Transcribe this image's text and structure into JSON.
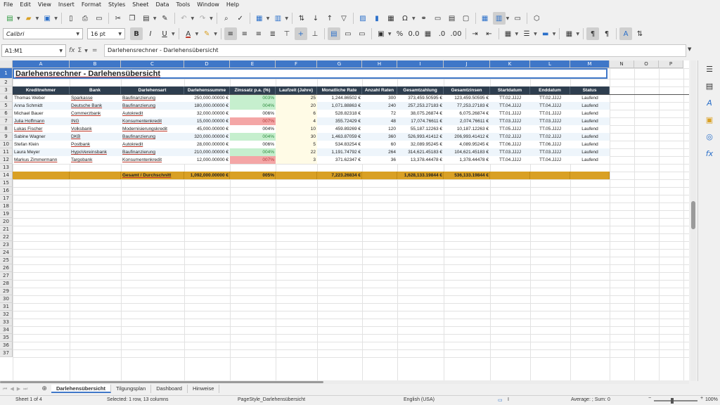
{
  "menu": [
    "File",
    "Edit",
    "View",
    "Insert",
    "Format",
    "Styles",
    "Sheet",
    "Data",
    "Tools",
    "Window",
    "Help"
  ],
  "toolbar": {
    "font_name": "Calibri",
    "font_size": "16 pt"
  },
  "formula_bar": {
    "name_box": "A1:M1",
    "content": "Darlehensrechner - Darlehensübersicht"
  },
  "columns": [
    "A",
    "B",
    "C",
    "D",
    "E",
    "F",
    "G",
    "H",
    "I",
    "J",
    "K",
    "L",
    "M",
    "N",
    "O",
    "P"
  ],
  "rows": [
    "1",
    "2",
    "3",
    "4",
    "5",
    "6",
    "7",
    "8",
    "9",
    "10",
    "11",
    "12",
    "13",
    "14",
    "15",
    "16",
    "17",
    "18",
    "19",
    "20",
    "21",
    "22",
    "23",
    "24",
    "25",
    "26",
    "27",
    "28",
    "29",
    "30",
    "31",
    "32",
    "33",
    "34",
    "35",
    "36",
    "37"
  ],
  "sheet": {
    "title": "Darlehensrechner - Darlehensübersicht",
    "headers": [
      "Kreditnehmer",
      "Bank",
      "Darlehensart",
      "Darlehenssumme",
      "Zinssatz p.a. (%)",
      "Laufzeit (Jahre)",
      "Monatliche Rate",
      "Anzahl Raten",
      "Gesamtzahlung",
      "Gesamtzinsen",
      "Startdatum",
      "Enddatum",
      "Status"
    ],
    "data": [
      [
        "Thomas Weber",
        "Sparkasse",
        "Baufinanzierung",
        "250,000.00000 €",
        "003%",
        "25",
        "1,244.86502 €",
        "300",
        "373,459.50595 €",
        "123,459.50595 €",
        "TT.02.JJJJ",
        "TT.02.JJJJ",
        "Laufend"
      ],
      [
        "Anna Schmidt",
        "Deutsche Bank",
        "Baufinanzierung",
        "180,000.00000 €",
        "004%",
        "20",
        "1,071.88863 €",
        "240",
        "257,253.27183 €",
        "77,253.27183 €",
        "TT.04.JJJJ",
        "TT.04.JJJJ",
        "Laufend"
      ],
      [
        "Michael Bauer",
        "Commerzbank",
        "Autokredit",
        "32,000.00000 €",
        "006%",
        "6",
        "528.82318 €",
        "72",
        "38,075.26874 €",
        "6,075.26874 €",
        "TT.01.JJJJ",
        "TT.01.JJJJ",
        "Laufend"
      ],
      [
        "Julia Hoffmann",
        "ING",
        "Konsumentenkredit",
        "15,000.00000 €",
        "007%",
        "4",
        "355.72429 €",
        "48",
        "17,074.76611 €",
        "2,074.76611 €",
        "TT.03.JJJJ",
        "TT.03.JJJJ",
        "Laufend"
      ],
      [
        "Lukas Fischer",
        "Volksbank",
        "Modernisierungskredit",
        "45,000.00000 €",
        "004%",
        "10",
        "459.89269 €",
        "120",
        "55,187.12263 €",
        "10,187.12263 €",
        "TT.05.JJJJ",
        "TT.05.JJJJ",
        "Laufend"
      ],
      [
        "Sabine Wagner",
        "DKB",
        "Baufinanzierung",
        "320,000.00000 €",
        "004%",
        "30",
        "1,463.87059 €",
        "360",
        "526,993.41412 €",
        "206,993.41412 €",
        "TT.02.JJJJ",
        "TT.02.JJJJ",
        "Laufend"
      ],
      [
        "Stefan Klein",
        "Postbank",
        "Autokredit",
        "28,000.00000 €",
        "006%",
        "5",
        "534.83254 €",
        "60",
        "32,089.95245 €",
        "4,089.95245 €",
        "TT.06.JJJJ",
        "TT.06.JJJJ",
        "Laufend"
      ],
      [
        "Laura Meyer",
        "HypoVereinsbank",
        "Baufinanzierung",
        "210,000.00000 €",
        "004%",
        "22",
        "1,191.74792 €",
        "264",
        "314,621.45183 €",
        "104,621.45183 €",
        "TT.03.JJJJ",
        "TT.03.JJJJ",
        "Laufend"
      ],
      [
        "Markus Zimmermann",
        "Targobank",
        "Konsumentenkredit",
        "12,000.00000 €",
        "007%",
        "3",
        "371.62347 €",
        "36",
        "13,378.44478 €",
        "1,378.44478 €",
        "TT.04.JJJJ",
        "TT.04.JJJJ",
        "Laufend"
      ]
    ],
    "totals": {
      "label": "Gesamt / Durchschnitt",
      "sum": "1,092,000.00000 €",
      "rate": "005%",
      "monthly": "7,223.26834 €",
      "total_payment": "1,628,133.19844 €",
      "total_interest": "536,133.19844 €"
    }
  },
  "tabs": [
    "Darlehensübersicht",
    "Tilgungsplan",
    "Dashboard",
    "Hinweise"
  ],
  "status": {
    "sheet": "Sheet 1 of 4",
    "selection": "Selected: 1 row, 13 columns",
    "page_style": "PageStyle_Darlehensübersicht",
    "language": "English (USA)",
    "summary": "Average: ; Sum: 0",
    "zoom": "100%"
  },
  "colors": {
    "header_bg": "#2e3e4f",
    "total_bg": "#d9a024",
    "low_rate_bg": "#c6efce",
    "low_rate_fg": "#2e8b3e",
    "high_rate_bg": "#f4a6a6",
    "high_rate_fg": "#b33a3a",
    "selection": "#3f77c8"
  },
  "rate_classes": [
    "low",
    "low",
    "none",
    "high",
    "none",
    "low",
    "none",
    "low",
    "high"
  ]
}
